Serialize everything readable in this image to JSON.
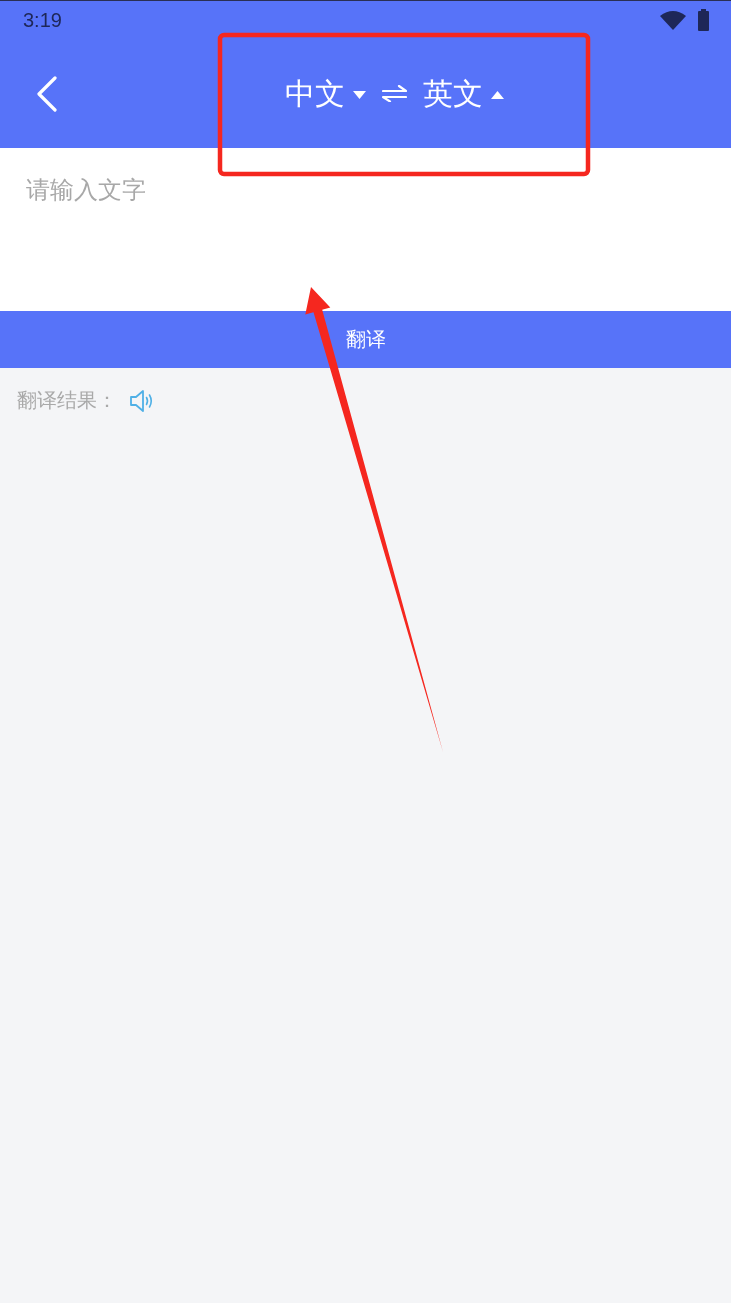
{
  "status_bar": {
    "time": "3:19"
  },
  "header": {
    "languages": [
      {
        "label": "中文",
        "expanded": false
      },
      {
        "label": "英文",
        "expanded": true
      }
    ]
  },
  "input": {
    "placeholder": "请输入文字"
  },
  "translate_button": {
    "label": "翻译"
  },
  "result": {
    "label": "翻译结果："
  },
  "annotations": [
    {
      "kind": "frame"
    },
    {
      "kind": "arrow"
    }
  ]
}
